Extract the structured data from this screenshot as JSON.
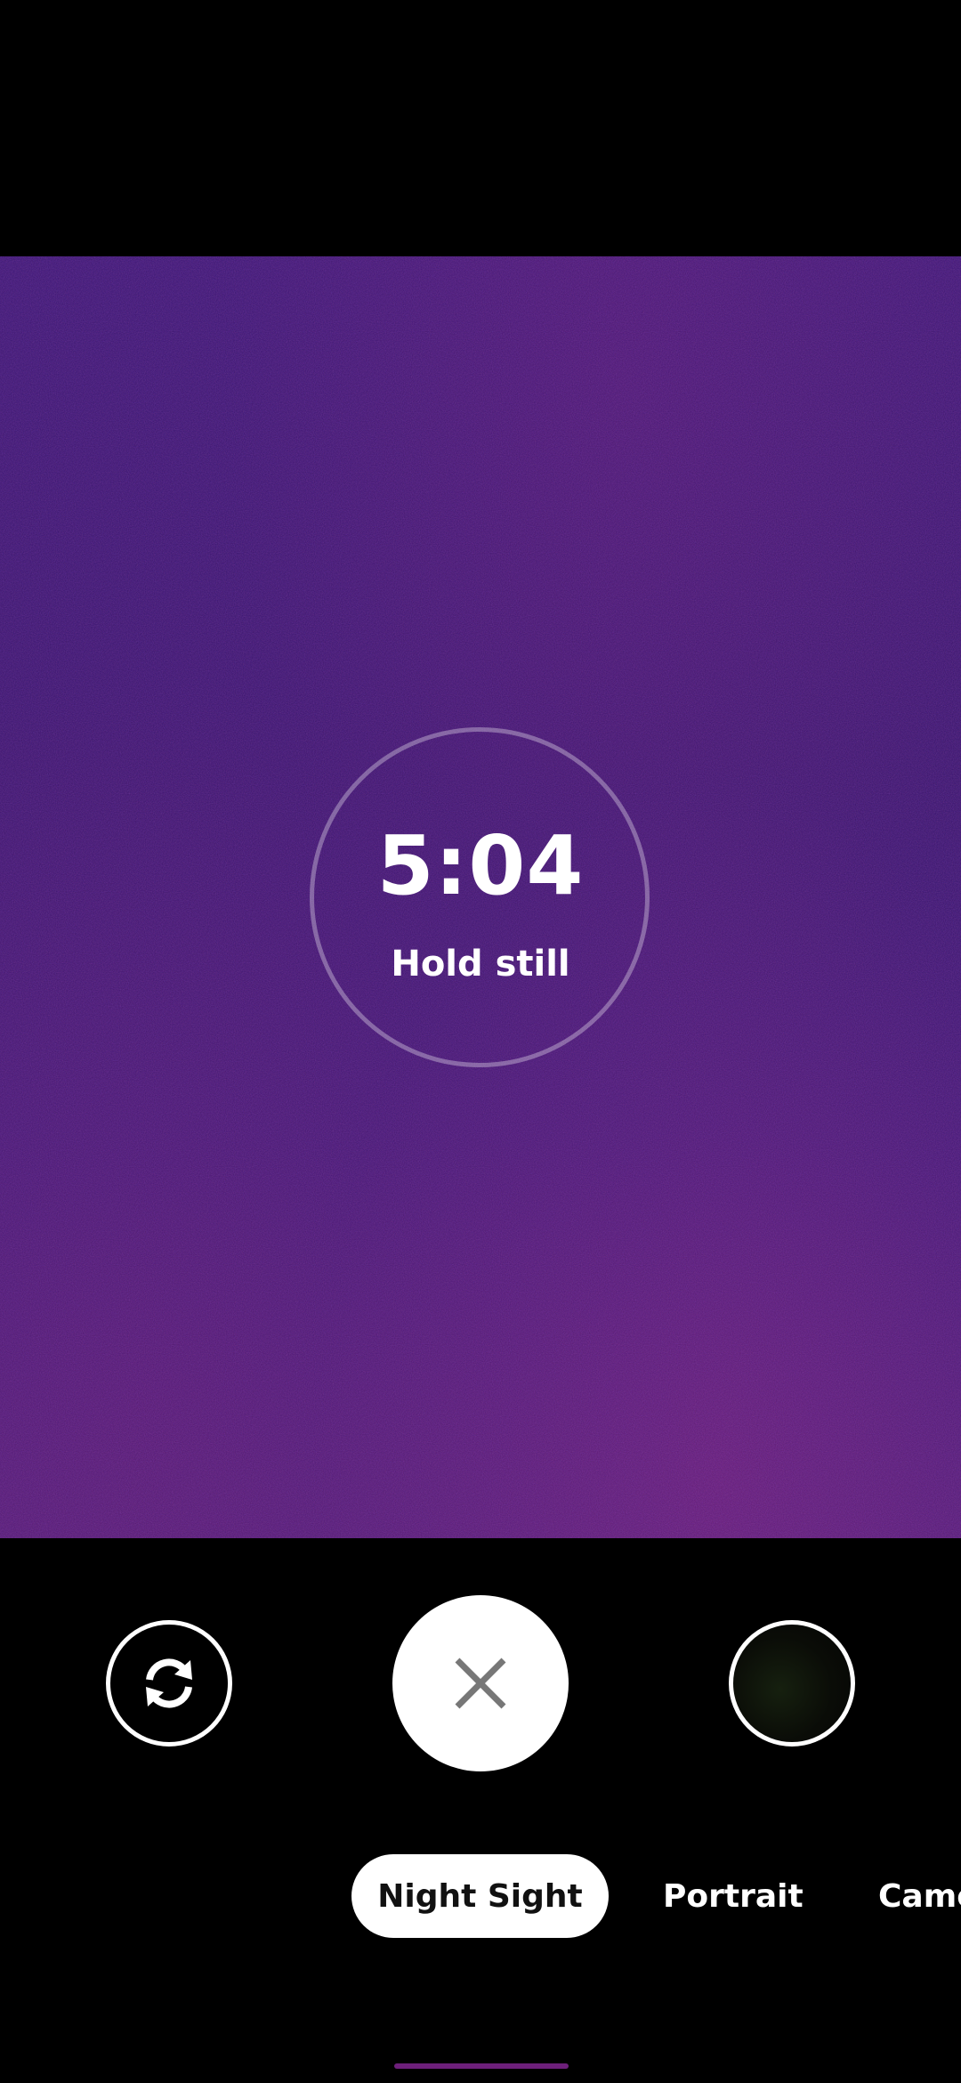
{
  "viewfinder": {
    "timer": "5:04",
    "caption": "Hold still"
  },
  "controls": {
    "switch_camera_icon": "switch-camera-icon",
    "cancel_icon": "close-icon",
    "gallery_icon": "gallery-thumbnail"
  },
  "modes": [
    {
      "label": "Night Sight",
      "selected": true
    },
    {
      "label": "Portrait",
      "selected": false
    },
    {
      "label": "Camera",
      "selected": false
    }
  ],
  "colors": {
    "viewfinder_tint": "#3a1670",
    "home_indicator": "#6d1f7a"
  }
}
